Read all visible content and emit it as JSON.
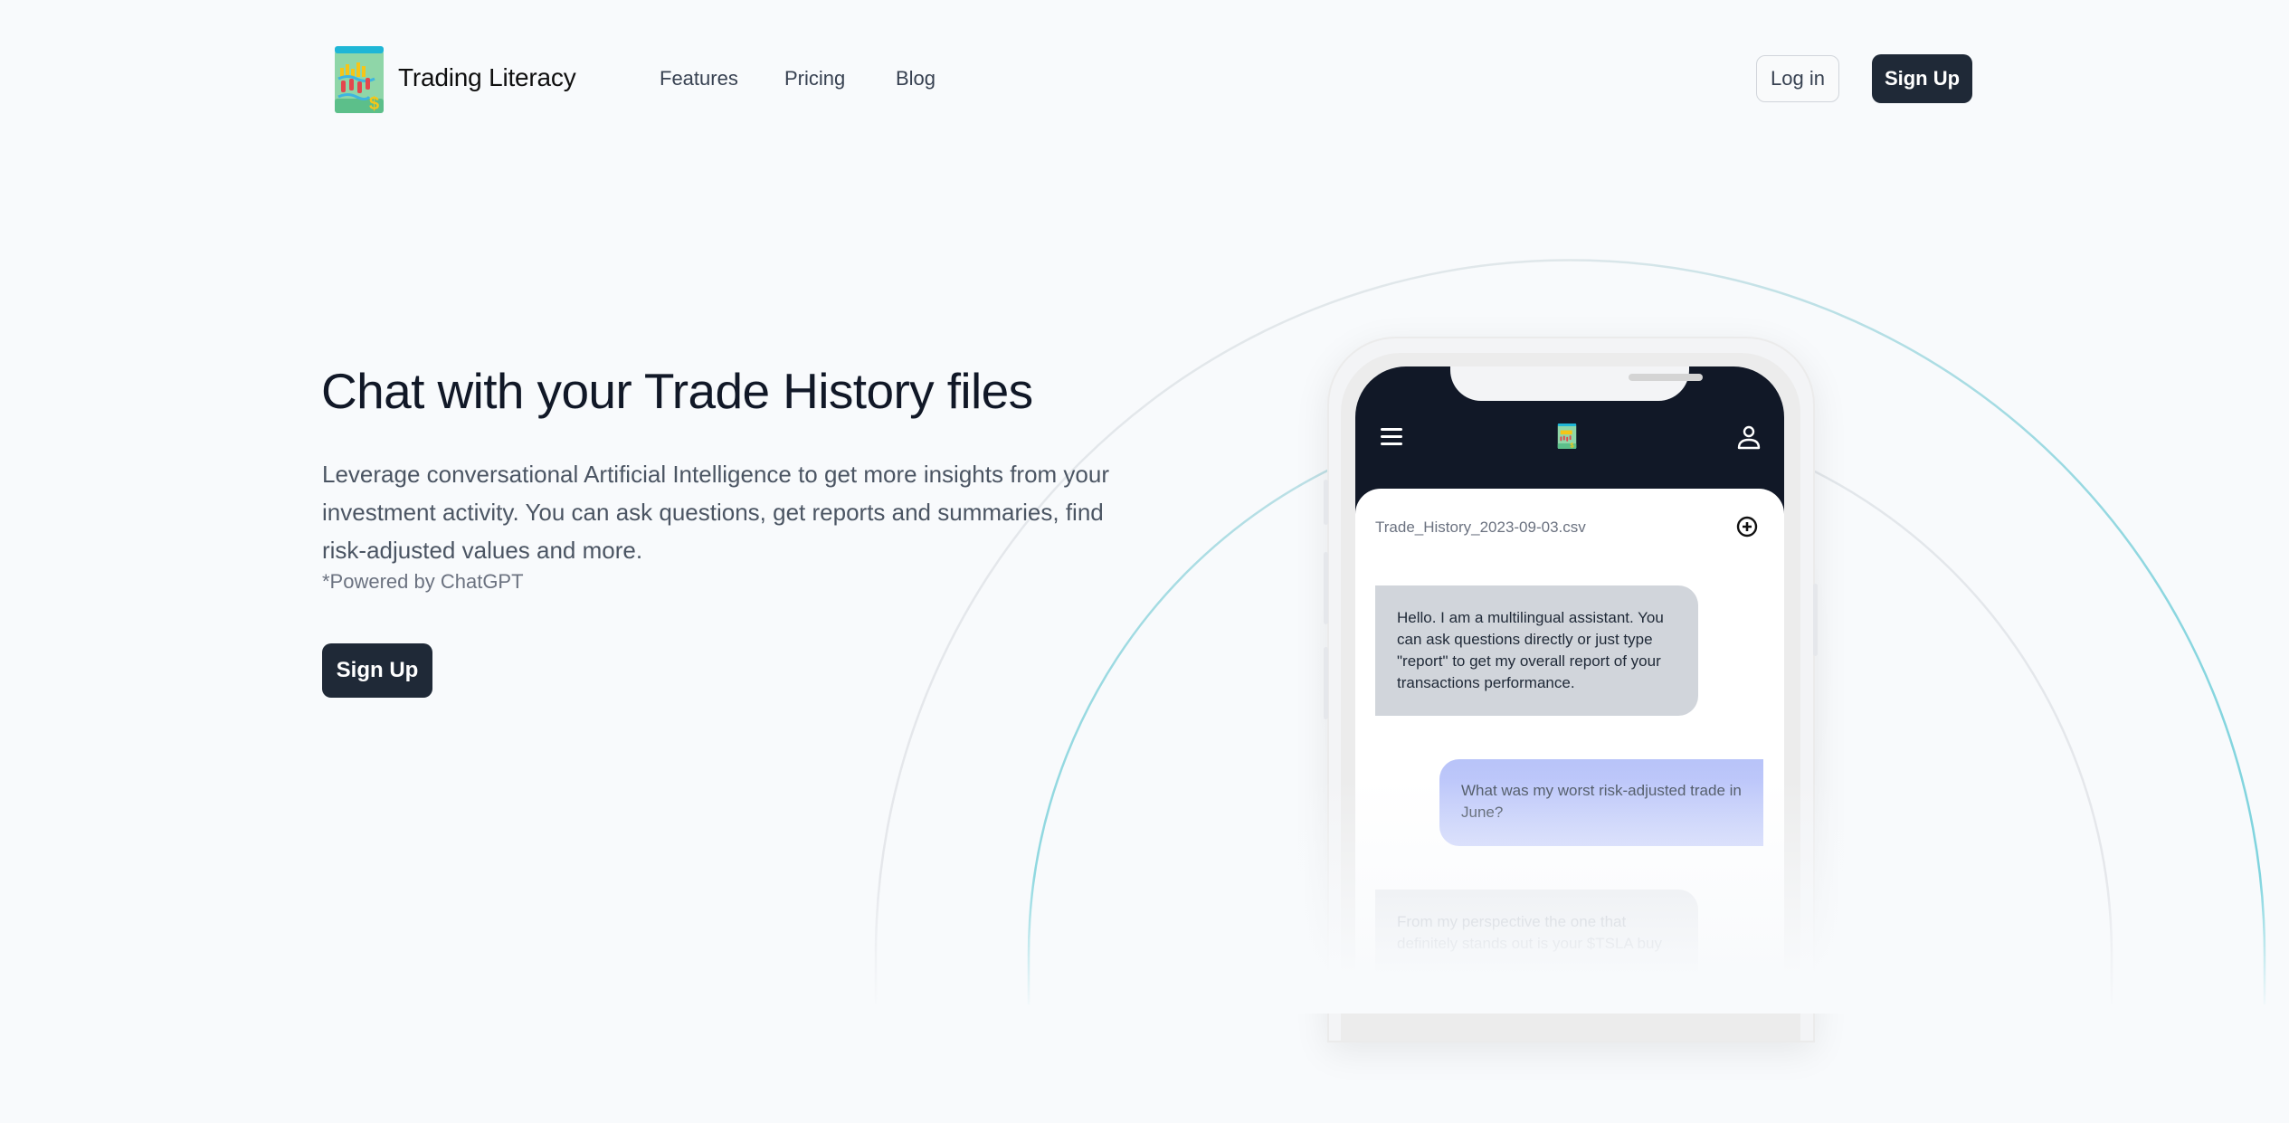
{
  "nav": {
    "brand": "Trading Literacy",
    "links": [
      "Features",
      "Pricing",
      "Blog"
    ],
    "login_label": "Log in",
    "signup_label": "Sign Up"
  },
  "hero": {
    "title": "Chat with your Trade History files",
    "description": "Leverage conversational Artificial Intelligence to get more insights from your investment activity. You can ask questions, get reports and summaries, find risk-adjusted values and more.",
    "note": "*Powered by ChatGPT",
    "cta_label": "Sign Up"
  },
  "phone": {
    "icons": {
      "menu": "hamburger-menu-icon",
      "logo": "book-chart-logo-icon",
      "user": "user-icon",
      "add": "plus-circle-icon"
    },
    "file_name": "Trade_History_2023-09-03.csv",
    "messages": [
      {
        "role": "assistant",
        "text": "Hello. I am a multilingual assistant. You can ask questions directly or just type \"report\" to get my overall report of your transactions performance."
      },
      {
        "role": "user",
        "text": "What was my worst risk-adjusted trade in June?"
      },
      {
        "role": "assistant",
        "text": "From my perspective the one that definitely stands out is your $TSLA buy"
      }
    ]
  },
  "colors": {
    "background": "#f8fafc",
    "primary_button": "#1f2937",
    "phone_header": "#111827",
    "assistant_bubble": "#d1d5db",
    "user_bubble": "#c0c9fa",
    "arc_accent": "#7dd3dc"
  }
}
